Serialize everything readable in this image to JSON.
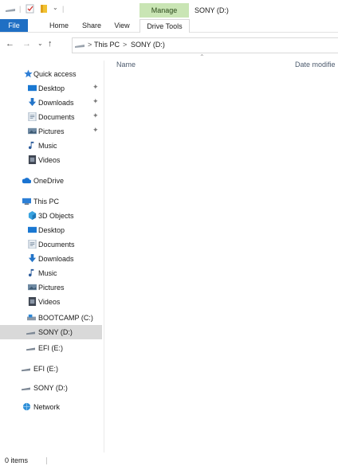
{
  "title_bar": {
    "contextual_tab": "Manage",
    "window_title": "SONY (D:)"
  },
  "ribbon": {
    "tabs": [
      "File",
      "Home",
      "Share",
      "View",
      "Drive Tools"
    ]
  },
  "address": {
    "crumbs": [
      "This PC",
      "SONY (D:)"
    ],
    "separator": ">"
  },
  "sidebar": {
    "items": [
      {
        "label": "Quick access",
        "icon": "star-icon"
      },
      {
        "label": "Desktop",
        "icon": "desktop-icon",
        "pinned": true
      },
      {
        "label": "Downloads",
        "icon": "download-icon",
        "pinned": true
      },
      {
        "label": "Documents",
        "icon": "documents-icon",
        "pinned": true
      },
      {
        "label": "Pictures",
        "icon": "pictures-icon",
        "pinned": true
      },
      {
        "label": "Music",
        "icon": "music-icon"
      },
      {
        "label": "Videos",
        "icon": "videos-icon"
      },
      {
        "label": "OneDrive",
        "icon": "cloud-icon"
      },
      {
        "label": "This PC",
        "icon": "computer-icon"
      },
      {
        "label": "3D Objects",
        "icon": "cube-icon"
      },
      {
        "label": "Desktop",
        "icon": "desktop-icon"
      },
      {
        "label": "Documents",
        "icon": "documents-icon"
      },
      {
        "label": "Downloads",
        "icon": "download-icon"
      },
      {
        "label": "Music",
        "icon": "music-icon"
      },
      {
        "label": "Pictures",
        "icon": "pictures-icon"
      },
      {
        "label": "Videos",
        "icon": "videos-icon"
      },
      {
        "label": "BOOTCAMP (C:)",
        "icon": "drive-icon"
      },
      {
        "label": "SONY (D:)",
        "icon": "usb-drive-icon",
        "selected": true
      },
      {
        "label": "EFI (E:)",
        "icon": "usb-drive-icon"
      },
      {
        "label": "EFI (E:)",
        "icon": "usb-drive-icon"
      },
      {
        "label": "SONY (D:)",
        "icon": "usb-drive-icon"
      },
      {
        "label": "Network",
        "icon": "network-icon"
      }
    ]
  },
  "columns": [
    "Name",
    "Date modifie"
  ],
  "status_bar": {
    "text": "0 items"
  },
  "colors": {
    "accent": "#1f6fc4",
    "manage_tab": "#c9e5b4",
    "selection": "#d9d9d9"
  }
}
